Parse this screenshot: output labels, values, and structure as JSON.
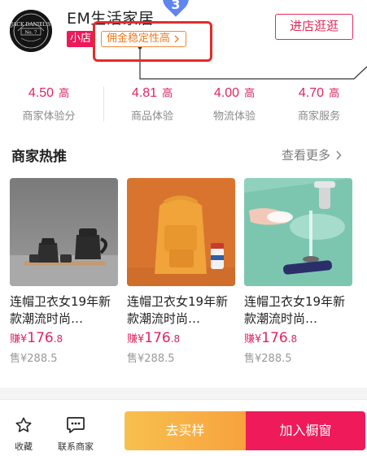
{
  "shop": {
    "name": "EM生活家居",
    "tag_small": "小店",
    "tag_commission": "佣金稳定性高",
    "enter_button": "进店逛逛",
    "step_marker": "3",
    "logo_text_top": "JACK DANIEL'S",
    "logo_text_bottom": "No. 7"
  },
  "ratings": [
    {
      "value": "4.50",
      "level": "高",
      "label": "商家体验分"
    },
    {
      "value": "4.81",
      "level": "高",
      "label": "商品体验"
    },
    {
      "value": "4.00",
      "level": "高",
      "label": "物流体验"
    },
    {
      "value": "4.70",
      "level": "高",
      "label": "商家服务"
    }
  ],
  "recommend": {
    "title": "商家热推",
    "see_more": "查看更多",
    "items": [
      {
        "title": "连帽卫衣女19年新款潮流时尚…",
        "earn_prefix": "赚¥",
        "earn_int": "176",
        "earn_dec": ".8",
        "price": "售¥288.5"
      },
      {
        "title": "连帽卫衣女19年新款潮流时尚…",
        "earn_prefix": "赚¥",
        "earn_int": "176",
        "earn_dec": ".8",
        "price": "售¥288.5"
      },
      {
        "title": "连帽卫衣女19年新款潮流时尚…",
        "earn_prefix": "赚¥",
        "earn_int": "176",
        "earn_dec": ".8",
        "price": "售¥288.5"
      }
    ]
  },
  "bottom": {
    "favorite": "收藏",
    "contact": "联系商家",
    "buy_sample": "去买样",
    "add_window": "加入橱窗"
  },
  "colors": {
    "accent": "#e0245e",
    "add_window_bg": "#ee1a5a",
    "buy_sample_bg": "#f8a23d",
    "commission_tag": "#f07a1d",
    "highlight_box": "#e52b2b",
    "step_marker": "#5f86ef"
  },
  "icons": [
    "star-outline-icon",
    "chat-bubble-icon",
    "chevron-right-icon"
  ]
}
